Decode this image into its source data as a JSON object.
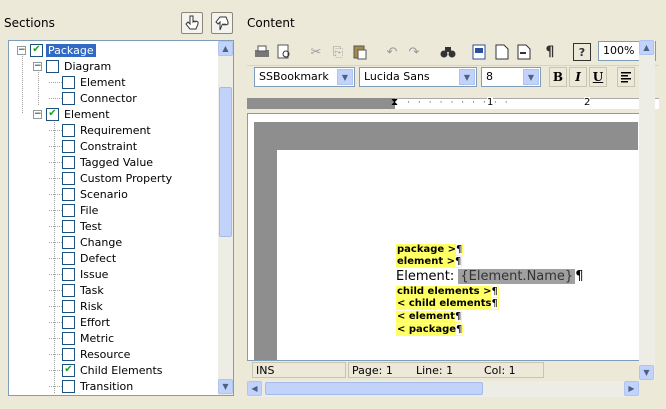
{
  "sections": {
    "title": "Sections",
    "tree": [
      {
        "label": "Package",
        "level": 0,
        "checked": true,
        "expander": "−",
        "selected": true
      },
      {
        "label": "Diagram",
        "level": 1,
        "checked": false,
        "expander": "−"
      },
      {
        "label": "Element",
        "level": 2,
        "checked": false
      },
      {
        "label": "Connector",
        "level": 2,
        "checked": false
      },
      {
        "label": "Element",
        "level": 1,
        "checked": true,
        "expander": "−"
      },
      {
        "label": "Requirement",
        "level": 2,
        "checked": false
      },
      {
        "label": "Constraint",
        "level": 2,
        "checked": false
      },
      {
        "label": "Tagged Value",
        "level": 2,
        "checked": false
      },
      {
        "label": "Custom Property",
        "level": 2,
        "checked": false
      },
      {
        "label": "Scenario",
        "level": 2,
        "checked": false
      },
      {
        "label": "File",
        "level": 2,
        "checked": false
      },
      {
        "label": "Test",
        "level": 2,
        "checked": false
      },
      {
        "label": "Change",
        "level": 2,
        "checked": false
      },
      {
        "label": "Defect",
        "level": 2,
        "checked": false
      },
      {
        "label": "Issue",
        "level": 2,
        "checked": false
      },
      {
        "label": "Task",
        "level": 2,
        "checked": false
      },
      {
        "label": "Risk",
        "level": 2,
        "checked": false
      },
      {
        "label": "Effort",
        "level": 2,
        "checked": false
      },
      {
        "label": "Metric",
        "level": 2,
        "checked": false
      },
      {
        "label": "Resource",
        "level": 2,
        "checked": false
      },
      {
        "label": "Child Elements",
        "level": 2,
        "checked": true
      },
      {
        "label": "Transition",
        "level": 2,
        "checked": false
      }
    ]
  },
  "content": {
    "title": "Content",
    "zoom": "100%",
    "style_combo": "SSBookmark",
    "font_combo": "Lucida Sans",
    "size_combo": "8",
    "ruler_marks": [
      "1",
      "2"
    ],
    "doc_lines": [
      {
        "text": "package >",
        "kind": "tag"
      },
      {
        "text": "element >",
        "kind": "tag"
      },
      {
        "prefix": "Element: ",
        "field": "{Element.Name}",
        "kind": "field"
      },
      {
        "text": "child elements >",
        "kind": "tag"
      },
      {
        "text": "< child elements",
        "kind": "tag"
      },
      {
        "text": "< element",
        "kind": "tag"
      },
      {
        "text": "< package",
        "kind": "tag"
      }
    ],
    "status": {
      "mode": "INS",
      "page": "Page: 1",
      "line": "Line: 1",
      "col": "Col: 1"
    }
  },
  "icons": {
    "pilcrow": "¶",
    "bold": "B",
    "italic": "I",
    "underline": "U",
    "help": "?"
  },
  "colors": {
    "highlight": "#ffff66",
    "field_bg": "#a0a0a0",
    "selection": "#316ac5",
    "check": "#21a121"
  }
}
